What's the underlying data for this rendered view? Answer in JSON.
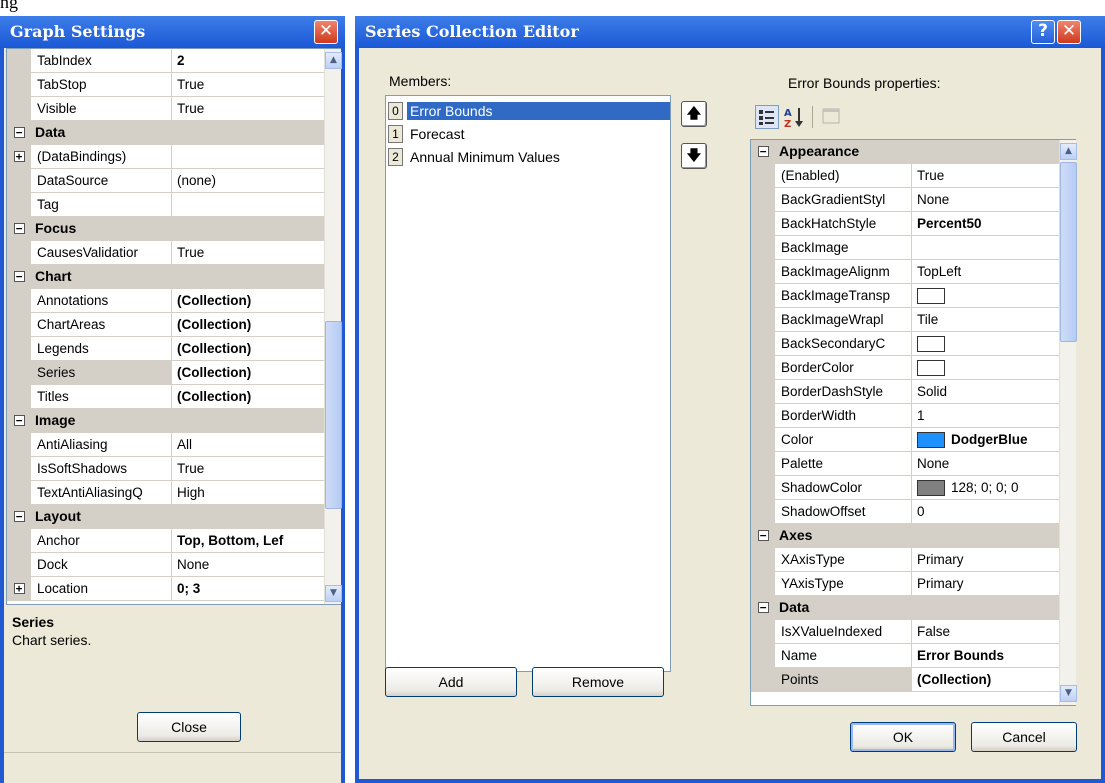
{
  "top_text": "ng",
  "graph_settings": {
    "title": "Graph Settings",
    "close_glyph": "✕",
    "rows": [
      {
        "type": "prop",
        "name": "TabIndex",
        "value": "2",
        "bold": true
      },
      {
        "type": "prop",
        "name": "TabStop",
        "value": "True"
      },
      {
        "type": "prop",
        "name": "Visible",
        "value": "True"
      },
      {
        "type": "cat",
        "name": "Data",
        "toggle": "−"
      },
      {
        "type": "prop",
        "name": "(DataBindings)",
        "value": "",
        "toggle": "+"
      },
      {
        "type": "prop",
        "name": "DataSource",
        "value": "(none)"
      },
      {
        "type": "prop",
        "name": "Tag",
        "value": ""
      },
      {
        "type": "cat",
        "name": "Focus",
        "toggle": "−"
      },
      {
        "type": "prop",
        "name": "CausesValidatior",
        "value": "True"
      },
      {
        "type": "cat",
        "name": "Chart",
        "toggle": "−"
      },
      {
        "type": "prop",
        "name": "Annotations",
        "value": "(Collection)",
        "bold": true
      },
      {
        "type": "prop",
        "name": "ChartAreas",
        "value": "(Collection)",
        "bold": true
      },
      {
        "type": "prop",
        "name": "Legends",
        "value": "(Collection)",
        "bold": true
      },
      {
        "type": "prop",
        "name": "Series",
        "value": "(Collection)",
        "bold": true,
        "selected": true
      },
      {
        "type": "prop",
        "name": "Titles",
        "value": "(Collection)",
        "bold": true
      },
      {
        "type": "cat",
        "name": "Image",
        "toggle": "−"
      },
      {
        "type": "prop",
        "name": "AntiAliasing",
        "value": "All"
      },
      {
        "type": "prop",
        "name": "IsSoftShadows",
        "value": "True"
      },
      {
        "type": "prop",
        "name": "TextAntiAliasingQ",
        "value": "High"
      },
      {
        "type": "cat",
        "name": "Layout",
        "toggle": "−"
      },
      {
        "type": "prop",
        "name": "Anchor",
        "value": "Top, Bottom, Lef",
        "bold": true
      },
      {
        "type": "prop",
        "name": "Dock",
        "value": "None"
      },
      {
        "type": "prop",
        "name": "Location",
        "value": "0; 3",
        "bold": true,
        "toggle": "+"
      }
    ],
    "description_title": "Series",
    "description_text": "Chart series.",
    "close_button": "Close"
  },
  "series_editor": {
    "title": "Series Collection Editor",
    "help_glyph": "?",
    "close_glyph": "✕",
    "members_label": "Members:",
    "members": [
      {
        "index": "0",
        "name": "Error Bounds",
        "selected": true
      },
      {
        "index": "1",
        "name": "Forecast"
      },
      {
        "index": "2",
        "name": "Annual Minimum Values"
      }
    ],
    "move_up_glyph": "🡅",
    "move_down_glyph": "🡇",
    "add_button": "Add",
    "remove_button": "Remove",
    "properties_label": "Error Bounds properties:",
    "rows": [
      {
        "type": "cat",
        "name": "Appearance",
        "toggle": "−"
      },
      {
        "type": "prop",
        "name": "(Enabled)",
        "value": "True"
      },
      {
        "type": "prop",
        "name": "BackGradientStyl",
        "value": "None"
      },
      {
        "type": "prop",
        "name": "BackHatchStyle",
        "value": "Percent50",
        "bold": true
      },
      {
        "type": "prop",
        "name": "BackImage",
        "value": ""
      },
      {
        "type": "prop",
        "name": "BackImageAlignm",
        "value": "TopLeft"
      },
      {
        "type": "prop",
        "name": "BackImageTransp",
        "value": "",
        "swatch": "#ffffff"
      },
      {
        "type": "prop",
        "name": "BackImageWrapl",
        "value": "Tile"
      },
      {
        "type": "prop",
        "name": "BackSecondaryC",
        "value": "",
        "swatch": "#ffffff"
      },
      {
        "type": "prop",
        "name": "BorderColor",
        "value": "",
        "swatch": "#ffffff"
      },
      {
        "type": "prop",
        "name": "BorderDashStyle",
        "value": "Solid"
      },
      {
        "type": "prop",
        "name": "BorderWidth",
        "value": "1"
      },
      {
        "type": "prop",
        "name": "Color",
        "value": "DodgerBlue",
        "bold": true,
        "swatch": "#1e90ff"
      },
      {
        "type": "prop",
        "name": "Palette",
        "value": "None"
      },
      {
        "type": "prop",
        "name": "ShadowColor",
        "value": "128; 0; 0; 0",
        "swatch": "#808080"
      },
      {
        "type": "prop",
        "name": "ShadowOffset",
        "value": "0"
      },
      {
        "type": "cat",
        "name": "Axes",
        "toggle": "−"
      },
      {
        "type": "prop",
        "name": "XAxisType",
        "value": "Primary"
      },
      {
        "type": "prop",
        "name": "YAxisType",
        "value": "Primary"
      },
      {
        "type": "cat",
        "name": "Data",
        "toggle": "−"
      },
      {
        "type": "prop",
        "name": "IsXValueIndexed",
        "value": "False"
      },
      {
        "type": "prop",
        "name": "Name",
        "value": "Error Bounds",
        "bold": true
      },
      {
        "type": "prop",
        "name": "Points",
        "value": "(Collection)",
        "bold": true,
        "selected": true
      }
    ],
    "ok_button": "OK",
    "cancel_button": "Cancel"
  }
}
